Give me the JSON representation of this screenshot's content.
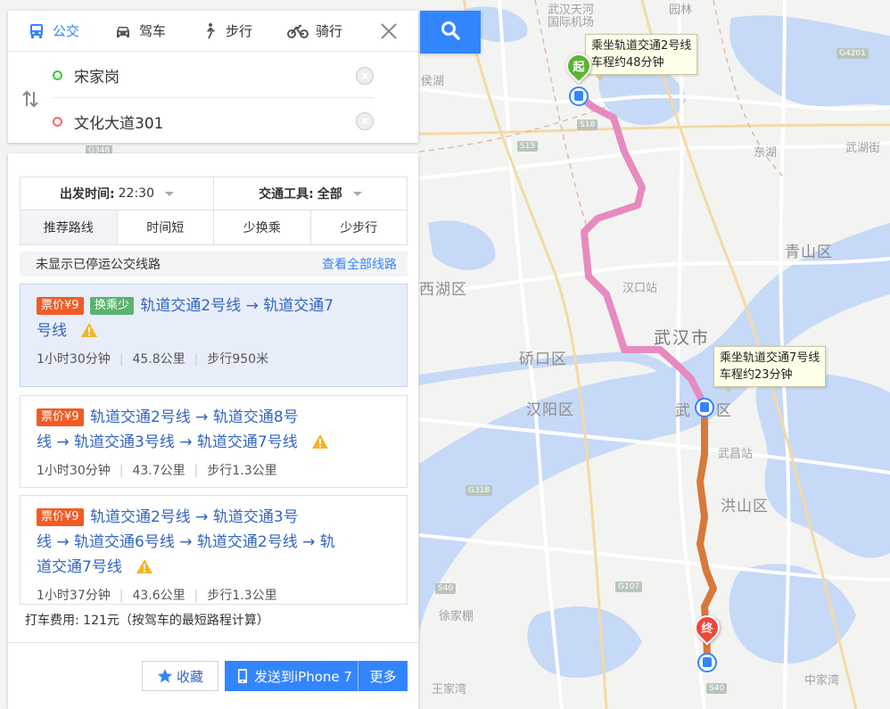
{
  "mode_tabs": [
    {
      "label": "公交",
      "active": true
    },
    {
      "label": "驾车",
      "active": false
    },
    {
      "label": "步行",
      "active": false
    },
    {
      "label": "骑行",
      "active": false
    }
  ],
  "search": {
    "start": "宋家岗",
    "end": "文化大道301"
  },
  "filters": {
    "depart_label": "出发时间:",
    "depart_value": "22:30",
    "transport_label": "交通工具:",
    "transport_value": "全部"
  },
  "route_tabs": [
    {
      "label": "推荐路线",
      "active": true
    },
    {
      "label": "时间短",
      "active": false
    },
    {
      "label": "少换乘",
      "active": false
    },
    {
      "label": "少步行",
      "active": false
    }
  ],
  "notice": {
    "text": "未显示已停运公交线路",
    "link": "查看全部线路"
  },
  "routes": [
    {
      "fare": "票价¥9",
      "tag": "换乘少",
      "line1": "轨道交通2号线 → 轨道交通7",
      "line2": "号线",
      "line3": "",
      "duration": "1小时30分钟",
      "distance": "45.8公里",
      "walk": "步行950米"
    },
    {
      "fare": "票价¥9",
      "tag": "",
      "line1": "轨道交通2号线 → 轨道交通8号",
      "line2": "线 → 轨道交通3号线 → 轨道交通7号线",
      "line3": "",
      "duration": "1小时30分钟",
      "distance": "43.7公里",
      "walk": "步行1.3公里"
    },
    {
      "fare": "票价¥9",
      "tag": "",
      "line1": "轨道交通2号线 → 轨道交通3号",
      "line2": "线 → 轨道交通6号线 → 轨道交通2号线 → 轨",
      "line3": "道交通7号线",
      "duration": "1小时37分钟",
      "distance": "43.6公里",
      "walk": "步行1.3公里"
    }
  ],
  "taxi_fare": "打车费用: 121元（按驾车的最短路程计算）",
  "buttons": {
    "favorite": "收藏",
    "send": "发送到iPhone 7",
    "more": "更多"
  },
  "map": {
    "start_marker": "起",
    "end_marker": "终",
    "callout1_line1": "乘坐轨道交通2号线",
    "callout1_line2": "车程约48分钟",
    "callout2_line1": "乘坐轨道交通7号线",
    "callout2_line2": "车程约23分钟",
    "labels": {
      "wuhan_city": "武汉市",
      "qingshan": "青山区",
      "qiaokou": "硚口区",
      "hanyang": "汉阳区",
      "hongshan": "洪山区",
      "dongxihu_frag": "西湖区",
      "wuchang_frag": "武",
      "wuchang_frag2": "区",
      "wuchang_station": "武昌站",
      "hankou_station": "汉口站",
      "dongxi": "东湖",
      "houhu": "侯湖",
      "airport1": "武汉天河",
      "airport2": "国际机场",
      "wuhu": "武湖街",
      "xujiapeng": "徐家棚",
      "wangjiawan": "王家湾",
      "zhongjiaju": "中家湾",
      "yuanling": "园林"
    },
    "road_signs": [
      "S18",
      "S15",
      "G318",
      "G107",
      "S40",
      "S40",
      "G4201",
      "G348"
    ],
    "route_colors": {
      "line2": "#e68ac0",
      "line7": "#d9783a"
    }
  }
}
